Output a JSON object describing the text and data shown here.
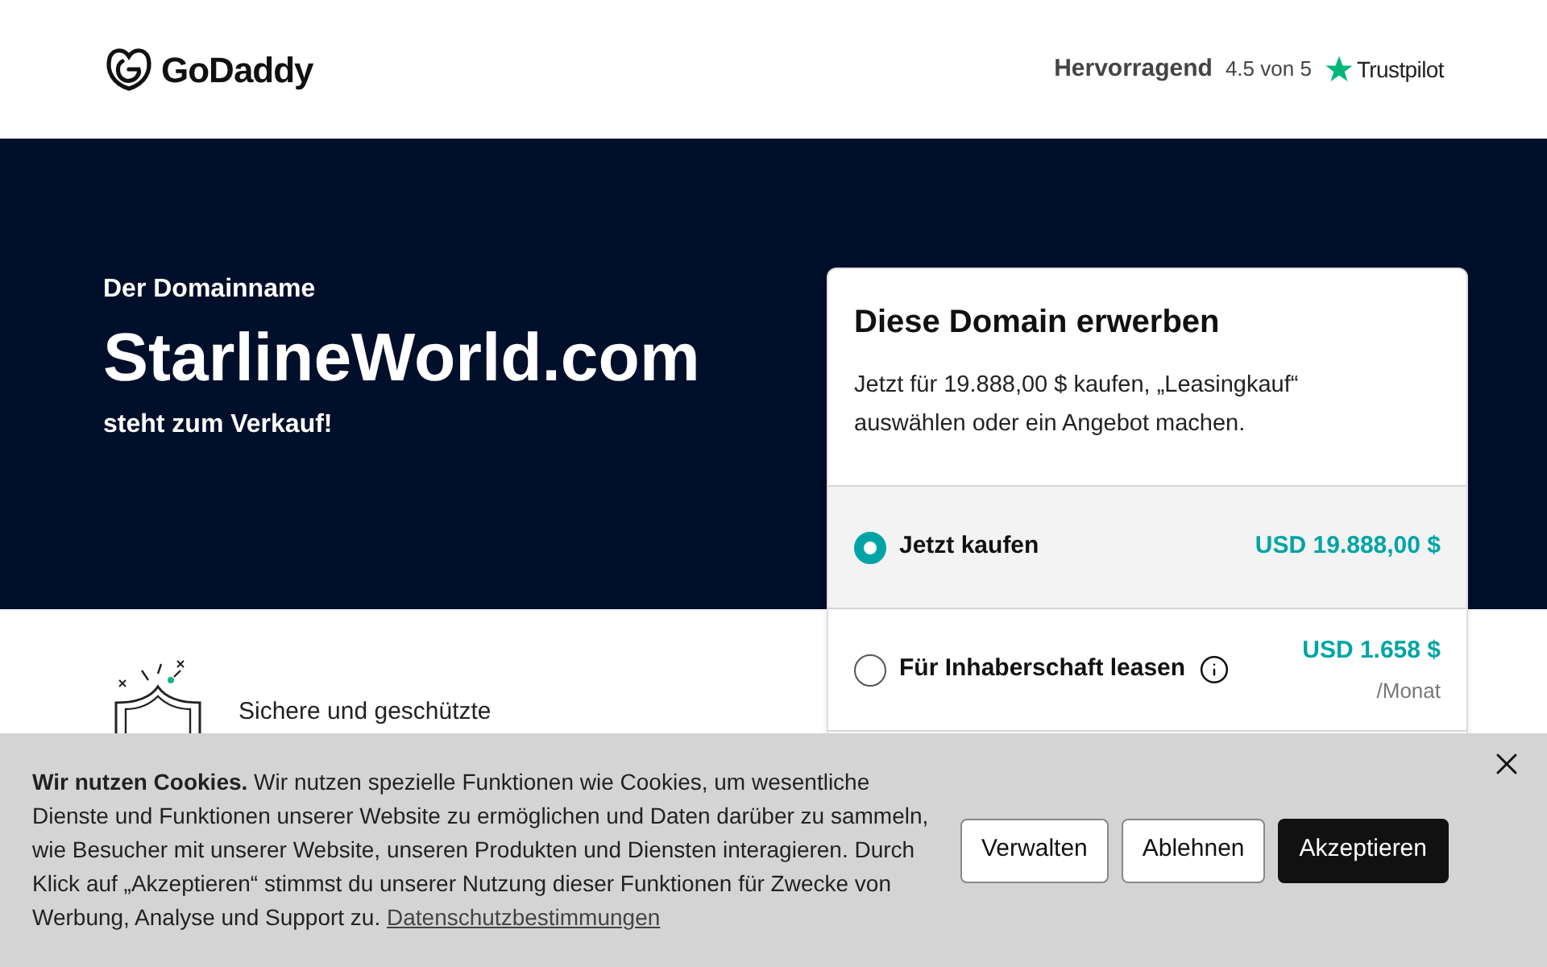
{
  "header": {
    "logo": "GoDaddy",
    "rating_label": "Hervorragend",
    "rating_score": "4.5 von 5",
    "rating_brand": "Trustpilot"
  },
  "hero": {
    "eyebrow": "Der Domainname",
    "domain": "StarlineWorld.com",
    "subtitle": "steht zum Verkauf!"
  },
  "purchase_card": {
    "title": "Diese Domain erwerben",
    "description": "Jetzt für 19.888,00 $ kaufen, „Leasingkauf“ auswählen oder ein Angebot machen.",
    "options": [
      {
        "label": "Jetzt kaufen",
        "price": "USD 19.888,00 $",
        "selected": true,
        "info": false
      },
      {
        "label": "Für Inhaberschaft leasen",
        "price": "USD 1.658 $",
        "period": "/Monat",
        "selected": false,
        "info": true
      }
    ]
  },
  "features": [
    {
      "label": "Sichere und geschützte"
    }
  ],
  "cookie_banner": {
    "text": "**Wir nutzen Cookies.** Wir nutzen spezielle Funktionen wie Cookies, um wesentliche Dienste und Funktionen unserer Website zu ermöglichen und Daten darüber zu sammeln, wie Besucher mit unserer Website, unseren Produkten und Diensten interagieren. Durch Klick auf „Akzeptieren“ stimmst du unserer Nutzung dieser Funktionen für Zwecke von Werbung, Analyse und Support zu.",
    "link": "Datenschutzbestimmungen",
    "buttons": [
      {
        "label": "Verwalten",
        "kind": "outline"
      },
      {
        "label": "Ablehnen",
        "kind": "outline"
      },
      {
        "label": "Akzeptieren",
        "kind": "primary"
      }
    ]
  }
}
